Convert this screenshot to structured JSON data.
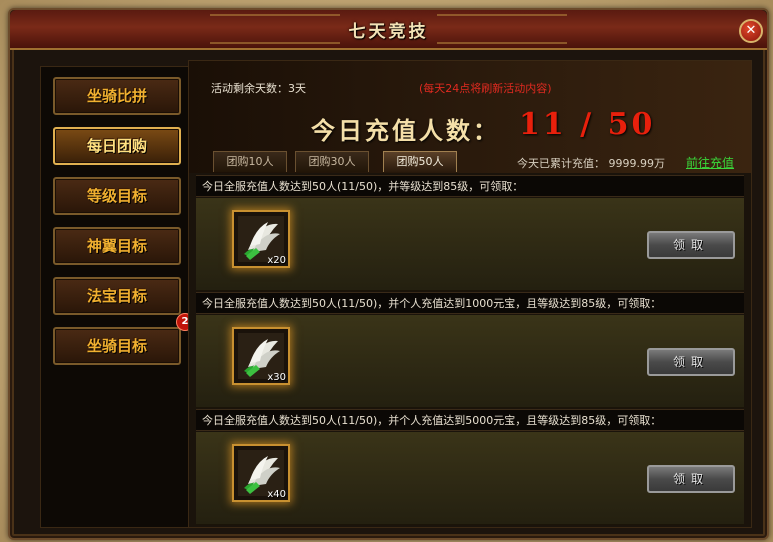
{
  "window": {
    "title": "七天竞技",
    "close_label": "✕"
  },
  "sidebar": {
    "items": [
      {
        "label": "坐骑比拼",
        "active": false
      },
      {
        "label": "每日团购",
        "active": true
      },
      {
        "label": "等级目标",
        "active": false
      },
      {
        "label": "神翼目标",
        "active": false
      },
      {
        "label": "法宝目标",
        "active": false
      },
      {
        "label": "坐骑目标",
        "active": false
      }
    ],
    "badge_count": "2"
  },
  "banner": {
    "remaining_days": "活动剩余天数：3天",
    "refresh_note": "(每天24点将刷新活动内容)",
    "today_label": "今日充值人数：",
    "today_count": "11 / 50"
  },
  "tabs": [
    {
      "label": "团购10人",
      "active": false
    },
    {
      "label": "团购30人",
      "active": false
    },
    {
      "label": "团购50人",
      "active": true
    }
  ],
  "recharge": {
    "today_total": "今天已累计充值： 9999.99万",
    "goto_label": "前往充值"
  },
  "rewards": [
    {
      "condition": "今日全服充值人数达到50人(11/50)，并等级达到85级，可领取：",
      "item_icon": "wing-feather-item-icon",
      "quantity": "x20",
      "claim_label": "领取"
    },
    {
      "condition": "今日全服充值人数达到50人(11/50)，并个人充值达到1000元宝，且等级达到85级，可领取：",
      "item_icon": "wing-feather-item-icon",
      "quantity": "x30",
      "claim_label": "领取"
    },
    {
      "condition": "今日全服充值人数达到50人(11/50)，并个人充值达到5000元宝，且等级达到85级，可领取：",
      "item_icon": "wing-feather-item-icon",
      "quantity": "x40",
      "claim_label": "领取"
    }
  ],
  "colors": {
    "accent_gold": "#f0b030",
    "count_red": "#e8200c",
    "link_green": "#3ad83a",
    "note_red": "#e02a20"
  }
}
